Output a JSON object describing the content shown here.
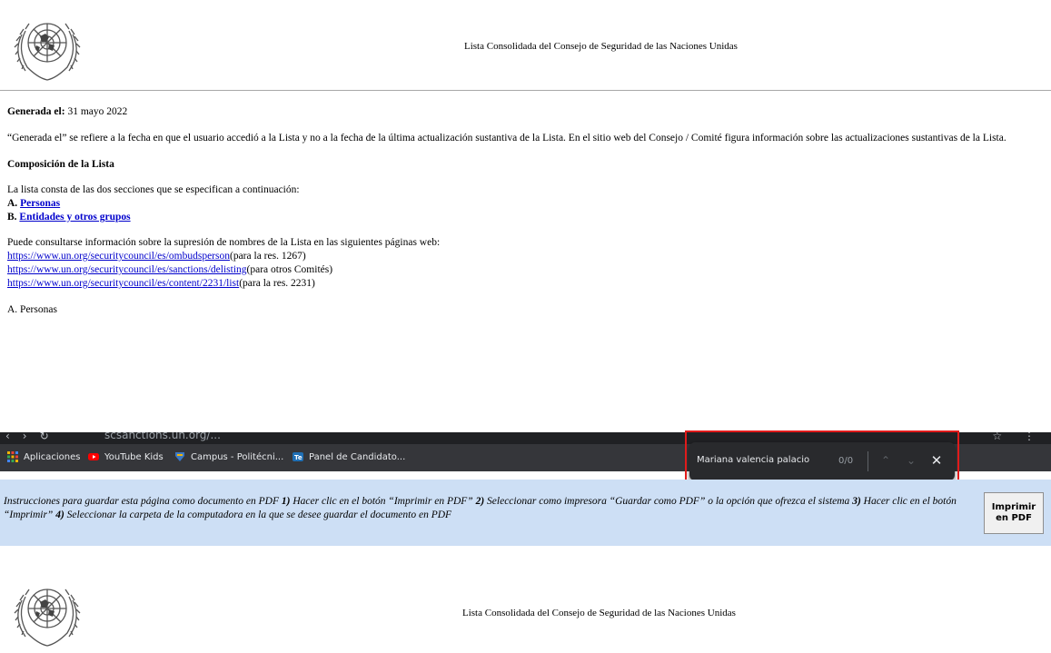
{
  "header": {
    "title": "Lista Consolidada del Consejo de Seguridad de las Naciones Unidas",
    "logo_icon": "un-emblem-icon"
  },
  "document": {
    "generated_label": "Generada el:",
    "generated_date": "31 mayo 2022",
    "generated_note": "“Generada el” se refiere a la fecha en que el usuario accedió a la Lista y no a la fecha de la última actualización sustantiva de la Lista. En el sitio web del Consejo / Comité figura información sobre las actualizaciones sustantivas de la Lista.",
    "composition_heading": "Composición de la Lista",
    "composition_intro": "La lista consta de las dos secciones que se especifican a continuación:",
    "section_a_prefix": "A.",
    "section_a_link": "Personas",
    "section_b_prefix": "B.",
    "section_b_link": "Entidades y otros grupos",
    "delisting_intro": "Puede consultarse información sobre la supresión de nombres de la Lista en las siguientes páginas web:",
    "links": [
      {
        "url": "https://www.un.org/securitycouncil/es/ombudsperson",
        "note": "(para la res. 1267)"
      },
      {
        "url": "https://www.un.org/securitycouncil/es/sanctions/delisting",
        "note": "(para otros Comités)"
      },
      {
        "url": "https://www.un.org/securitycouncil/es/content/2231/list",
        "note": "(para la res. 2231)"
      }
    ],
    "section_a_title": "A. Personas"
  },
  "browser": {
    "url_partial": "scsanctions.un.org/...",
    "bookmarks": [
      {
        "label": "Aplicaciones",
        "icon": "apps-grid-icon",
        "color": "#f4b400"
      },
      {
        "label": "YouTube Kids",
        "icon": "youtube-kids-icon",
        "color": "#ff0000"
      },
      {
        "label": "Campus - Politécni...",
        "icon": "campus-icon",
        "color": "#3b78c4"
      },
      {
        "label": "Panel de Candidato...",
        "icon": "panel-icon",
        "color": "#1f6fb5"
      }
    ],
    "find": {
      "query": "Mariana valencia palacio",
      "count": "0/0"
    }
  },
  "instructions": {
    "text_1": "Instrucciones para guardar esta página como documento en PDF ",
    "step1_num": "1)",
    "text_2": " Hacer clic en el botón “Imprimir en PDF” ",
    "step2_num": "2)",
    "text_3": " Seleccionar como impresora “Guardar como PDF” o la opción que ofrezca el sistema ",
    "step3_num": "3)",
    "text_4": " Hacer clic en el botón “Imprimir” ",
    "step4_num": "4)",
    "text_5": " Seleccionar la carpeta de la computadora en la que se desee guardar el documento en PDF",
    "print_button_line1": "Imprimir",
    "print_button_line2": "en PDF"
  }
}
